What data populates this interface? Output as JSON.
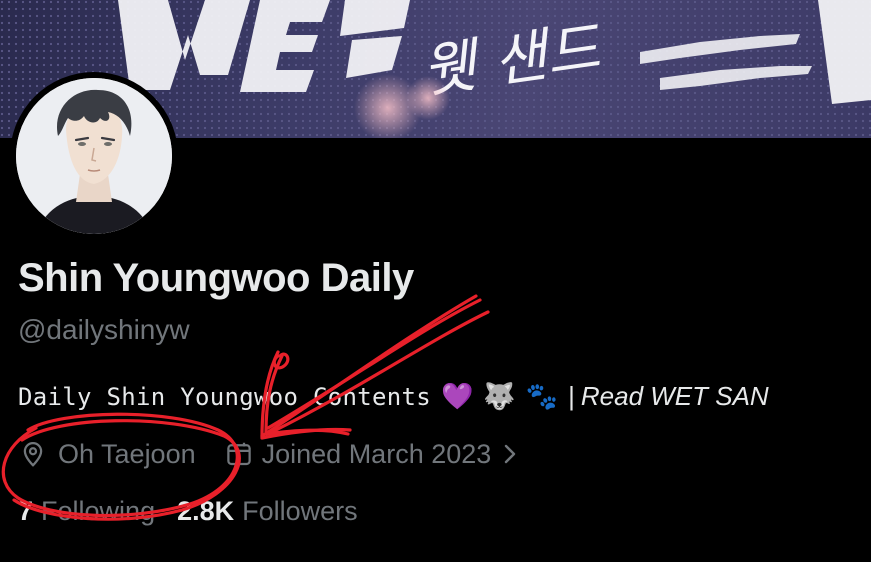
{
  "profile": {
    "display_name": "Shin Youngwoo Daily",
    "handle": "@dailyshinyw",
    "bio": {
      "text": "Daily Shin Youngwoo Contents",
      "emojis": [
        "💜",
        "🐺",
        "🐾"
      ],
      "separator": "|",
      "link_text": "Read WET SAN"
    },
    "location": "Oh Taejoon",
    "joined": "Joined March 2023"
  },
  "stats": {
    "following_count": "7",
    "following_label": "Following",
    "followers_count": "2.8K",
    "followers_label": "Followers"
  },
  "banner": {
    "korean_title": "웻 샌드"
  },
  "colors": {
    "background": "#000000",
    "primary_text": "#e7e9ea",
    "secondary_text": "#71767b",
    "annotation_red": "#e8202a"
  },
  "icons": [
    "location-pin-icon",
    "calendar-icon",
    "chevron-right-icon"
  ]
}
